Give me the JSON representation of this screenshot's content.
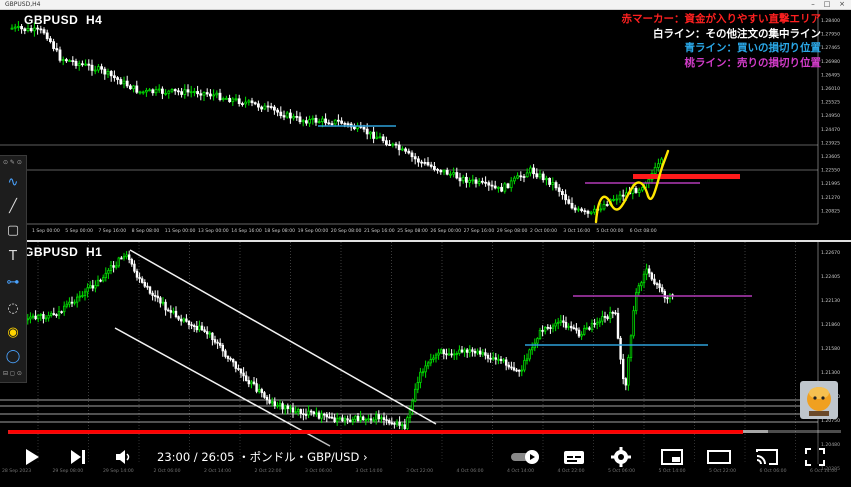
{
  "window": {
    "title": "GBPUSD,H4"
  },
  "chart_h4": {
    "symbol": "GBPUSD",
    "timeframe": "H4",
    "price_labels": [
      "1.28400",
      "1.27950",
      "1.27465",
      "1.26980",
      "1.26495",
      "1.26010",
      "1.25525",
      "1.24950",
      "1.24470",
      "1.23925",
      "1.23605",
      "1.22550",
      "1.21995",
      "1.21270",
      "1.20825"
    ],
    "date_labels": [
      "1 Sep 00:00",
      "5 Sep 00:00",
      "7 Sep 16:00",
      "8 Sep 08:00",
      "11 Sep 00:00",
      "13 Sep 00:00",
      "14 Sep 16:00",
      "18 Sep 08:00",
      "19 Sep 00:00",
      "20 Sep 08:00",
      "21 Sep 16:00",
      "25 Sep 08:00",
      "26 Sep 00:00",
      "27 Sep 16:00",
      "29 Sep 08:00",
      "2 Oct 00:00",
      "3 Oct 16:00",
      "5 Oct 00:00",
      "6 Oct 08:00"
    ]
  },
  "chart_h1": {
    "symbol": "GBPUSD",
    "timeframe": "H1",
    "price_labels": [
      "1.22670",
      "1.22405",
      "1.22130",
      "1.21860",
      "1.21580",
      "1.21300",
      "1.21010",
      "1.20750",
      "1.20480",
      "1.20205"
    ],
    "date_labels": [
      "28 Sep 2023",
      "29 Sep 08:00",
      "29 Sep 14:00",
      "2 Oct 06:00",
      "2 Oct 14:00",
      "2 Oct 22:00",
      "3 Oct 06:00",
      "3 Oct 14:00",
      "3 Oct 22:00",
      "4 Oct 06:00",
      "4 Oct 14:00",
      "4 Oct 22:00",
      "5 Oct 06:00",
      "5 Oct 14:00",
      "5 Oct 22:00",
      "6 Oct 06:00",
      "6 Oct 14:00"
    ]
  },
  "legend": {
    "red": {
      "text": "赤マーカー：資金が入りやすい直撃エリア",
      "color": "#ff2020"
    },
    "white": {
      "text": "白ライン：その他注文の集中ライン",
      "color": "#ffffff"
    },
    "blue": {
      "text": "青ライン：買いの損切り位置",
      "color": "#2aa7e6"
    },
    "pink": {
      "text": "桃ライン：売りの損切り位置",
      "color": "#d23cc8"
    }
  },
  "colors": {
    "bull_candle": "#00e000",
    "bear_candle": "#ffffff",
    "background": "#000000",
    "red_marker": "#ff1a1a",
    "blue_line": "#2e9fd8",
    "pink_line": "#b23ab8",
    "yellow_path": "#ffe600",
    "progress_played": "#ff0000"
  },
  "toolbar": {
    "tools": [
      "curve-tool-icon",
      "line-tool-icon",
      "rectangle-tool-icon",
      "text-tool-icon",
      "connector-tool-icon",
      "eraser-icon",
      "highlighter-icon",
      "lasso-icon"
    ]
  },
  "player": {
    "current_time": "23:00",
    "duration": "26:05",
    "time_separator": " / ",
    "chapter": "・ポンドル・GBP/USD",
    "chapter_arrow": "›",
    "progress": 0.882
  }
}
